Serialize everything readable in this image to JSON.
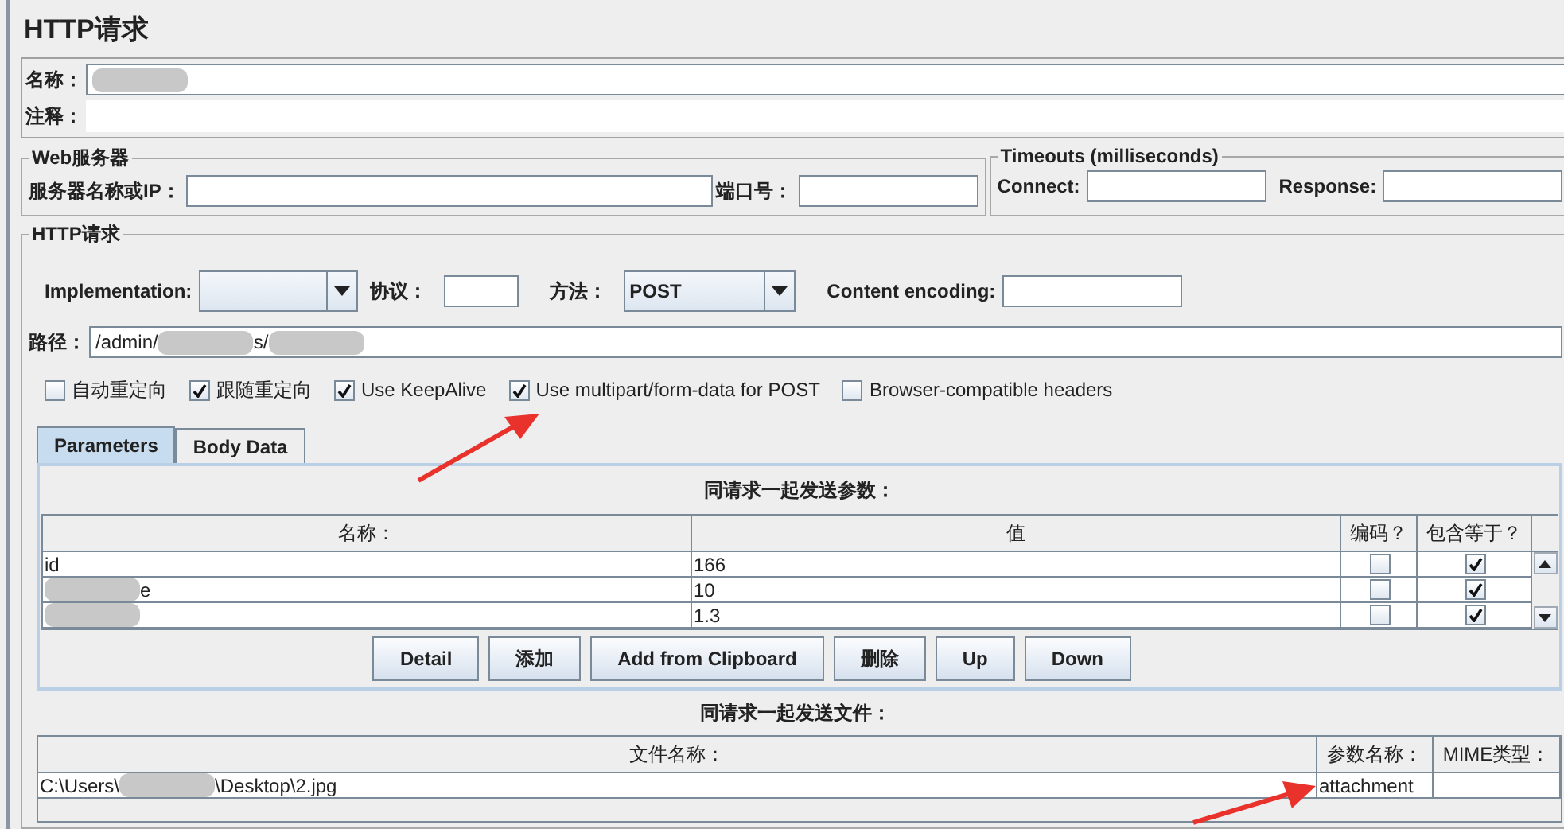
{
  "title": "HTTP请求",
  "name_field": {
    "label": "名称：",
    "segments": [
      {
        "kind": "blur"
      }
    ]
  },
  "comment_field": {
    "label": "注释："
  },
  "web_server": {
    "legend": "Web服务器",
    "server_label": "服务器名称或IP：",
    "port_label": "端口号："
  },
  "timeouts": {
    "legend": "Timeouts (milliseconds)",
    "connect_label": "Connect:",
    "response_label": "Response:"
  },
  "http_request": {
    "legend": "HTTP请求",
    "implementation_label": "Implementation:",
    "protocol_label": "协议：",
    "method_label": "方法：",
    "method_value": "POST",
    "encoding_label": "Content encoding:",
    "path_label": "路径：",
    "path_segments": [
      {
        "kind": "text",
        "text": "/admin/"
      },
      {
        "kind": "blur"
      },
      {
        "kind": "text",
        "text": "s/"
      },
      {
        "kind": "blur"
      }
    ]
  },
  "options": [
    {
      "label": "自动重定向",
      "checked": false
    },
    {
      "label": "跟随重定向",
      "checked": true
    },
    {
      "label": "Use KeepAlive",
      "checked": true
    },
    {
      "label": "Use multipart/form-data for POST",
      "checked": true
    },
    {
      "label": "Browser-compatible headers",
      "checked": false
    }
  ],
  "tabs": [
    {
      "label": "Parameters",
      "selected": true
    },
    {
      "label": "Body Data",
      "selected": false
    }
  ],
  "parameters": {
    "caption": "同请求一起发送参数：",
    "columns": [
      "名称：",
      "值",
      "编码？",
      "包含等于？"
    ],
    "rows": [
      {
        "name_segments": [
          {
            "kind": "text",
            "text": "id"
          }
        ],
        "value": "166",
        "encode": false,
        "include_equals": true
      },
      {
        "name_segments": [
          {
            "kind": "blur"
          },
          {
            "kind": "text",
            "text": "e"
          }
        ],
        "value": "10",
        "encode": false,
        "include_equals": true
      },
      {
        "name_segments": [
          {
            "kind": "blur"
          }
        ],
        "value": "1.3",
        "encode": false,
        "include_equals": true
      }
    ]
  },
  "buttons": [
    "Detail",
    "添加",
    "Add from Clipboard",
    "删除",
    "Up",
    "Down"
  ],
  "files": {
    "caption": "同请求一起发送文件：",
    "columns": [
      "文件名称：",
      "参数名称：",
      "MIME类型："
    ],
    "rows": [
      {
        "path_segments": [
          {
            "kind": "text",
            "text": "C:\\Users\\"
          },
          {
            "kind": "blur"
          },
          {
            "kind": "text",
            "text": "\\Desktop\\2.jpg"
          }
        ],
        "param_name": "attachment"
      }
    ]
  }
}
